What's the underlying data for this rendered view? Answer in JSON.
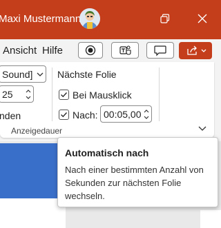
{
  "titlebar": {
    "user_name": "Maxi Mustermann",
    "background_color": "#c43e1c",
    "icons": [
      "avatar",
      "restore-icon",
      "close-icon"
    ]
  },
  "ribbon_tabs": {
    "tabs": [
      "Ansicht",
      "Hilfe"
    ],
    "icons": [
      "record-icon",
      "teams-icon",
      "comment-icon",
      "share-icon",
      "chevron-down-icon"
    ]
  },
  "ribbon": {
    "sound_dropdown_value": "Sound]",
    "duration_value": "25",
    "partial_label": "nden",
    "next_slide_heading": "Nächste Folie",
    "on_click_label": "Bei Mausklick",
    "on_click_checked": true,
    "after_label": "Nach:",
    "after_checked": true,
    "after_value": "00:05,00",
    "group_label": "Anzeigedauer"
  },
  "tooltip": {
    "title": "Automatisch nach",
    "body": "Nach einer bestimmten Anzahl von Sekunden zur nächsten Folie wechseln."
  },
  "colors": {
    "accent": "#c43e1c",
    "slide_blue": "#3a6fc9"
  }
}
